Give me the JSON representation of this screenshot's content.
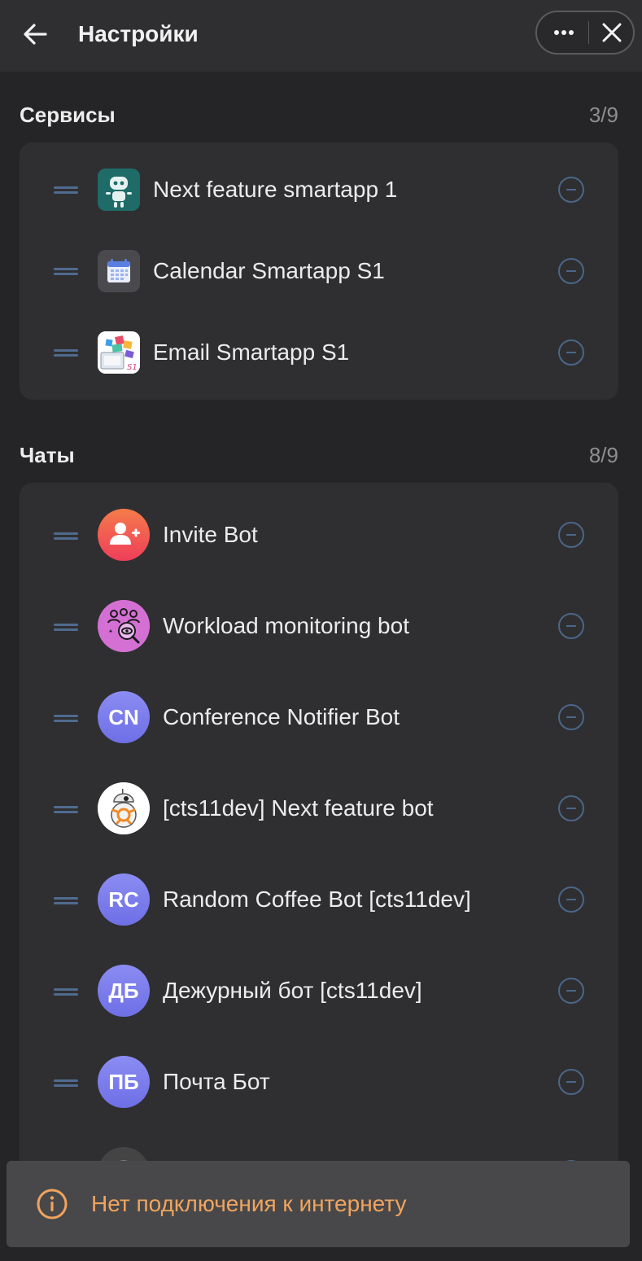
{
  "header": {
    "title": "Настройки",
    "back_icon": "arrow-left-icon",
    "more_icon": "more-horizontal-icon",
    "close_icon": "close-icon"
  },
  "services": {
    "title": "Сервисы",
    "count": "3/9",
    "items": [
      {
        "label": "Next feature smartapp 1",
        "icon": "robot-icon"
      },
      {
        "label": "Calendar Smartapp S1",
        "icon": "calendar-icon"
      },
      {
        "label": "Email Smartapp S1",
        "icon": "email-collage-icon"
      }
    ]
  },
  "chats": {
    "title": "Чаты",
    "count": "8/9",
    "items": [
      {
        "label": "Invite Bot",
        "avatar": "add-user-icon"
      },
      {
        "label": "Workload monitoring bot",
        "avatar": "team-monitor-icon"
      },
      {
        "label": "Conference Notifier Bot",
        "initials": "CN"
      },
      {
        "label": "[cts11dev] Next feature bot",
        "avatar": "droid-icon"
      },
      {
        "label": "Random Coffee Bot [cts11dev]",
        "initials": "RC"
      },
      {
        "label": "Дежурный бот [cts11dev]",
        "initials": "ДБ"
      },
      {
        "label": "Почта Бот",
        "initials": "ПБ"
      }
    ]
  },
  "toast": {
    "text": "Нет подключения к интернету",
    "icon": "info-icon"
  },
  "colors": {
    "background": "#252527",
    "card": "#2f2f31",
    "accent_icon": "#4b6688",
    "toast_text": "#f0a45e",
    "avatar_initials": "#7e7ef0"
  }
}
